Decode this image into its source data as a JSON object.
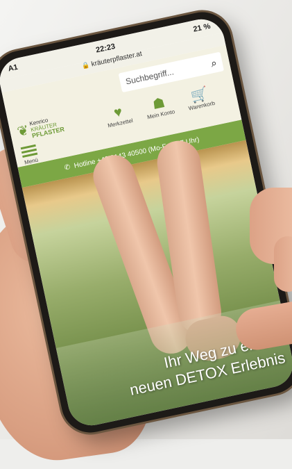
{
  "status": {
    "carrier": "A1",
    "time": "22:23",
    "battery": "21 %"
  },
  "browser": {
    "url": "kräuterpflaster.at"
  },
  "search": {
    "placeholder": "Suchbegriff..."
  },
  "logo": {
    "line1": "Kenrico",
    "line2": "KRÄUTER",
    "line3": "PFLASTER"
  },
  "nav": {
    "wishlist_label": "Merkzettel",
    "account_label": "Mein Konto",
    "cart_label": "Warenkorb",
    "menu_label": "Menü"
  },
  "hotline": {
    "text": "Hotline +43 3143 40500 (Mo-Fr 8-17 Uhr)"
  },
  "hero": {
    "line1": "Ihr Weg zu einem",
    "line2": "neuen DETOX Erlebnis"
  },
  "colors": {
    "accent": "#7ca745",
    "header_bg": "#f3f1e2"
  }
}
